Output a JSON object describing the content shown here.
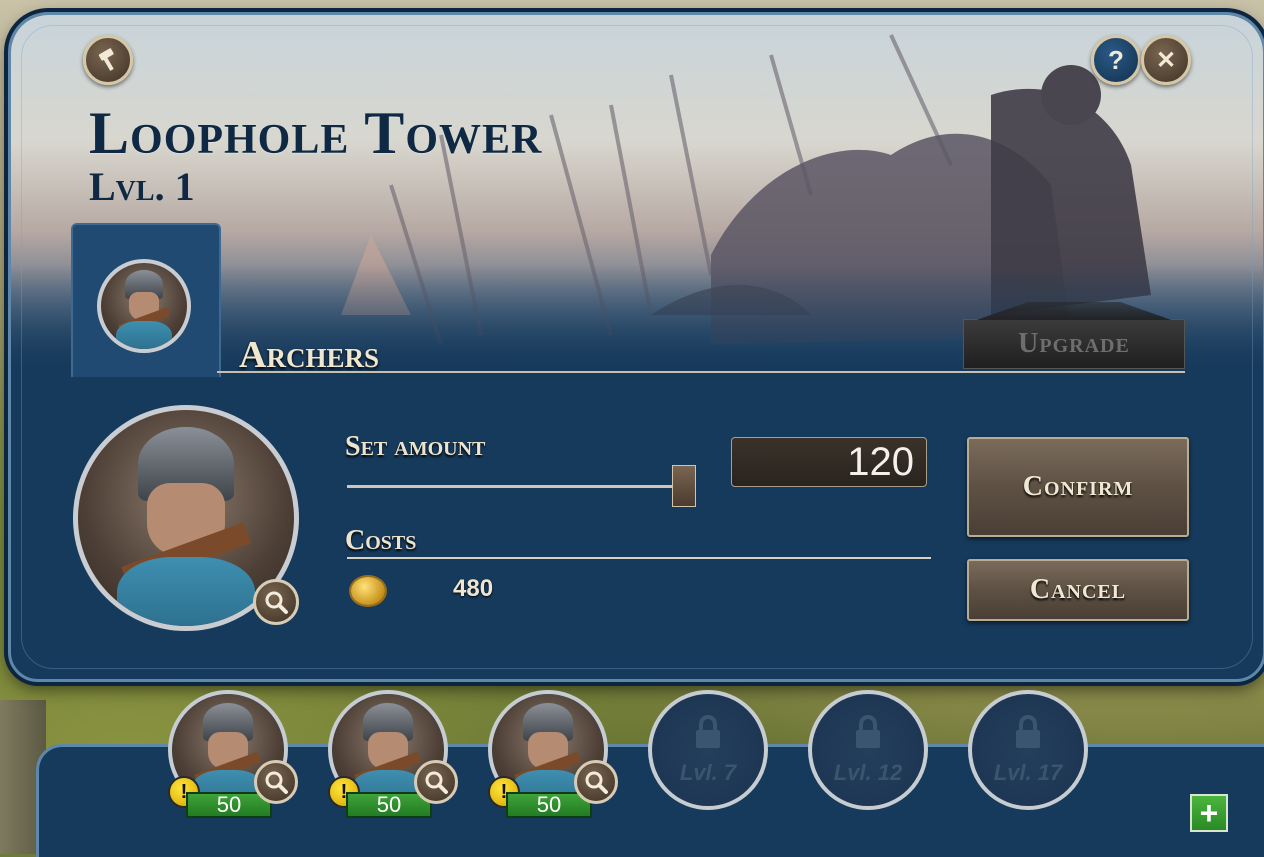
{
  "building": {
    "title": "Loophole Tower",
    "level": "Lvl. 1"
  },
  "header_buttons": {
    "back_icon": "hammer-icon",
    "help_label": "?",
    "close_label": "✕"
  },
  "unit": {
    "name": "Archers"
  },
  "upgrade_label": "Upgrade",
  "recruit": {
    "set_amount_label": "Set amount",
    "amount_value": "120",
    "slider_fraction": 0.98,
    "costs_label": "Costs",
    "cost_icon": "gold-coin-icon",
    "cost_value": "480"
  },
  "actions": {
    "confirm_label": "Confirm",
    "cancel_label": "Cancel"
  },
  "queue": {
    "slots": [
      {
        "state": "filled",
        "count": "50",
        "warning": "!"
      },
      {
        "state": "filled",
        "count": "50",
        "warning": "!"
      },
      {
        "state": "filled",
        "count": "50",
        "warning": "!"
      },
      {
        "state": "locked",
        "label": "Lvl. 7"
      },
      {
        "state": "locked",
        "label": "Lvl. 12"
      },
      {
        "state": "locked",
        "label": "Lvl. 17"
      }
    ],
    "add_label": "+"
  },
  "colors": {
    "panel": "#163a5c",
    "title": "#0f2944",
    "count_badge": "#2f9a2c",
    "warning": "#ffd21a"
  }
}
